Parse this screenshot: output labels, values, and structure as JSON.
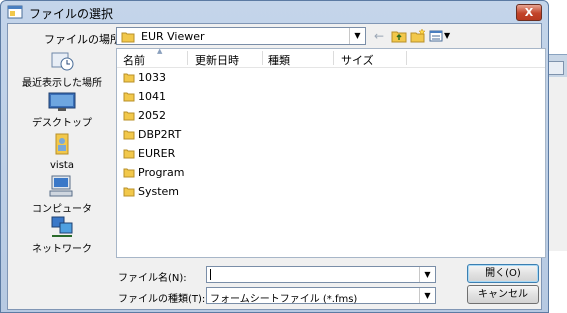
{
  "dialog": {
    "title": "ファイルの選択",
    "close_glyph": "X"
  },
  "lookin": {
    "label": "ファイルの場所(I):",
    "value": "EUR Viewer"
  },
  "toolbar": {
    "back_glyph": "←"
  },
  "places": [
    {
      "label": "最近表示した場所",
      "icon": "recent-places-icon"
    },
    {
      "label": "デスクトップ",
      "icon": "desktop-icon"
    },
    {
      "label": "vista",
      "icon": "user-folder-icon"
    },
    {
      "label": "コンピュータ",
      "icon": "computer-icon"
    },
    {
      "label": "ネットワーク",
      "icon": "network-icon"
    }
  ],
  "columns": [
    "名前",
    "更新日時",
    "種類",
    "サイズ"
  ],
  "files": [
    "1033",
    "1041",
    "2052",
    "DBP2RT",
    "EURER",
    "Program",
    "System"
  ],
  "filename": {
    "label": "ファイル名(N):",
    "value": ""
  },
  "filetype": {
    "label": "ファイルの種類(T):",
    "value": "フォームシートファイル (*.fms)"
  },
  "buttons": {
    "open": "開く(O)",
    "cancel": "キャンセル"
  }
}
